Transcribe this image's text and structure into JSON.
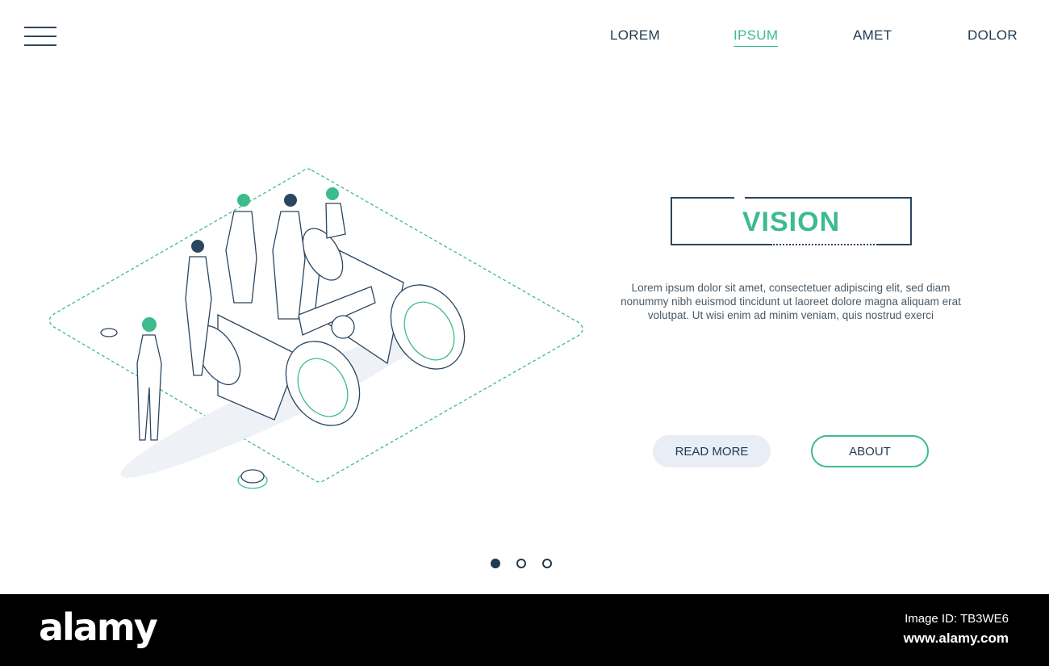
{
  "nav": {
    "items": [
      {
        "label": "LOREM"
      },
      {
        "label": "IPSUM",
        "active": true
      },
      {
        "label": "AMET"
      },
      {
        "label": "DOLOR"
      }
    ]
  },
  "hero": {
    "title": "VISION",
    "body": "Lorem ipsum dolor sit amet, consectetuer adipiscing elit, sed diam nonummy nibh euismod tincidunt ut laoreet dolore magna aliquam erat volutpat. Ut wisi enim ad minim veniam, quis nostrud exerci",
    "read_more": "READ MORE",
    "about": "ABOUT"
  },
  "pagination": {
    "current": 1,
    "total": 3
  },
  "footer": {
    "logo": "alamy",
    "image_id": "Image ID: TB3WE6",
    "url": "www.alamy.com"
  },
  "colors": {
    "accent": "#3dbb8d",
    "dark": "#1f3a52"
  }
}
